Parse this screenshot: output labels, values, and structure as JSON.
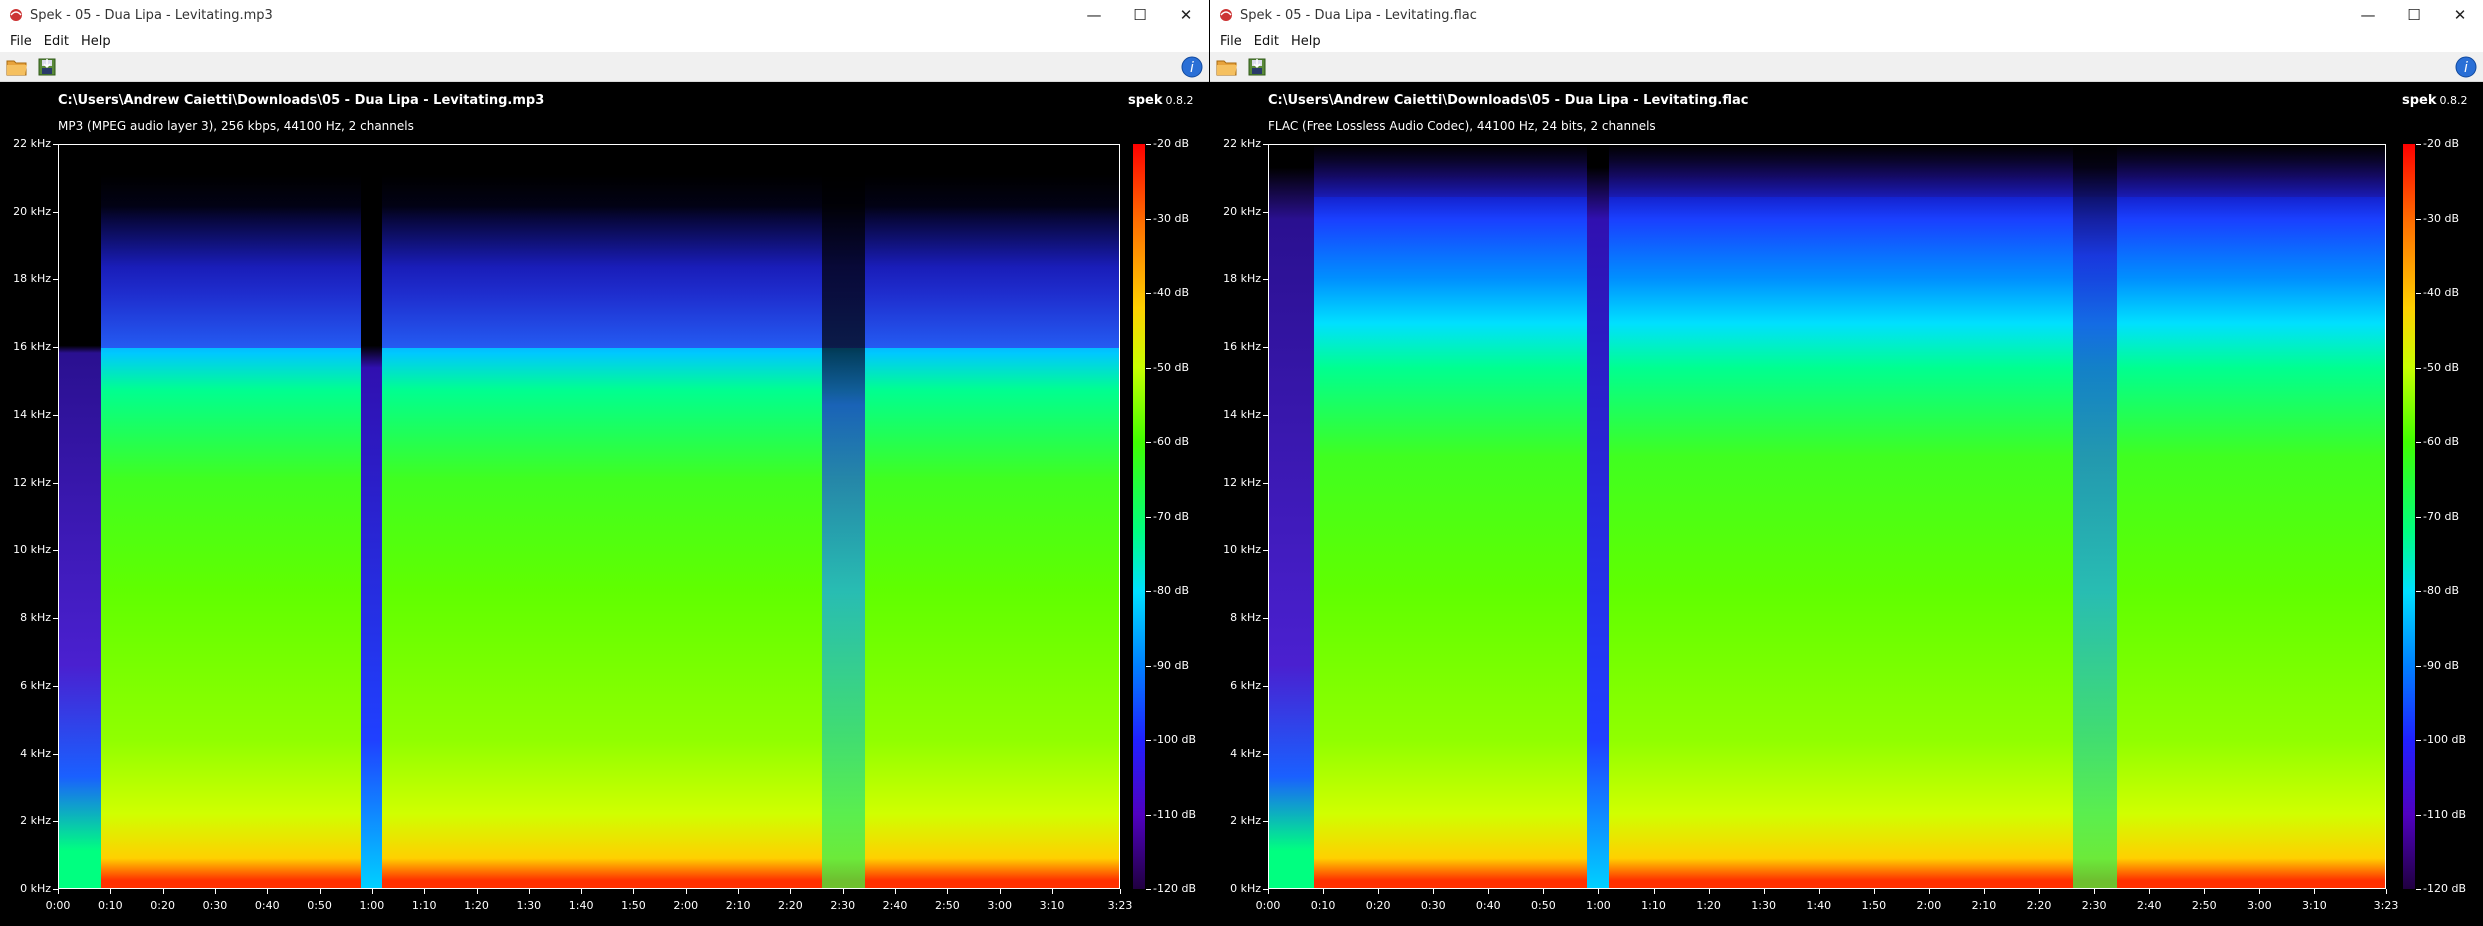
{
  "windows": [
    {
      "id": "left",
      "title": "Spek - 05 - Dua Lipa - Levitating.mp3",
      "menu": [
        "File",
        "Edit",
        "Help"
      ],
      "file_path": "C:\\Users\\Andrew Caietti\\Downloads\\05 - Dua Lipa - Levitating.mp3",
      "file_info": "MP3 (MPEG audio layer 3), 256 kbps, 44100 Hz, 2 channels",
      "cutoff_khz": 16
    },
    {
      "id": "right",
      "title": "Spek - 05 - Dua Lipa - Levitating.flac",
      "menu": [
        "File",
        "Edit",
        "Help"
      ],
      "file_path": "C:\\Users\\Andrew Caietti\\Downloads\\05 - Dua Lipa - Levitating.flac",
      "file_info": "FLAC (Free Lossless Audio Codec), 44100 Hz, 24 bits, 2 channels",
      "cutoff_khz": 20.5
    }
  ],
  "brand": {
    "name": "spek",
    "version": "0.8.2"
  },
  "window_controls": {
    "minimize": "—",
    "maximize": "☐",
    "close": "✕"
  },
  "icons": [
    "open-file-icon",
    "save-image-icon",
    "help-icon",
    "spek-app-icon"
  ],
  "freq_ticks": [
    "22 kHz",
    "20 kHz",
    "18 kHz",
    "16 kHz",
    "14 kHz",
    "12 kHz",
    "10 kHz",
    "8 kHz",
    "6 kHz",
    "4 kHz",
    "2 kHz",
    "0 kHz"
  ],
  "time_ticks": [
    "0:00",
    "0:10",
    "0:20",
    "0:30",
    "0:40",
    "0:50",
    "1:00",
    "1:10",
    "1:20",
    "1:30",
    "1:40",
    "1:50",
    "2:00",
    "2:10",
    "2:20",
    "2:30",
    "2:40",
    "2:50",
    "3:00",
    "3:10",
    "3:23"
  ],
  "db_ticks": [
    "-20 dB",
    "-30 dB",
    "-40 dB",
    "-50 dB",
    "-60 dB",
    "-70 dB",
    "-80 dB",
    "-90 dB",
    "-100 dB",
    "-110 dB",
    "-120 dB"
  ],
  "colors": {
    "background": "#000000",
    "titlebar": "#ffffff",
    "toolbar": "#f0f0f0",
    "text": "#ffffff"
  }
}
